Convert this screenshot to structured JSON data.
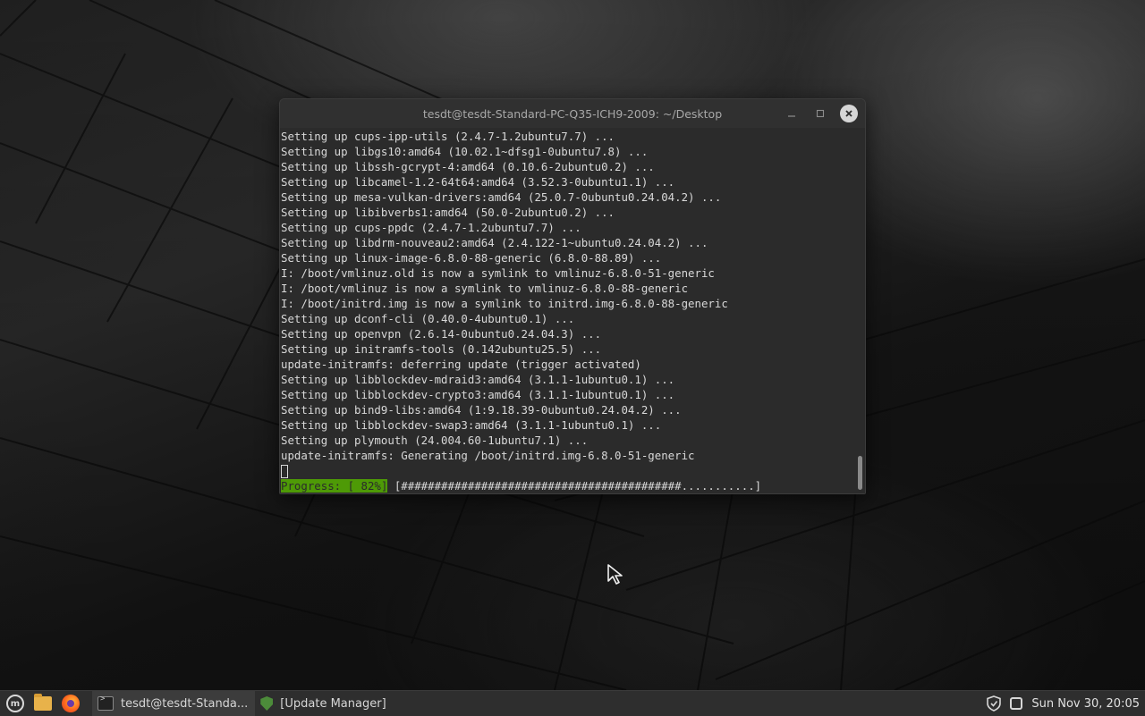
{
  "terminal": {
    "title": "tesdt@tesdt-Standard-PC-Q35-ICH9-2009: ~/Desktop",
    "lines": [
      "Setting up cups-ipp-utils (2.4.7-1.2ubuntu7.7) ...",
      "Setting up libgs10:amd64 (10.02.1~dfsg1-0ubuntu7.8) ...",
      "Setting up libssh-gcrypt-4:amd64 (0.10.6-2ubuntu0.2) ...",
      "Setting up libcamel-1.2-64t64:amd64 (3.52.3-0ubuntu1.1) ...",
      "Setting up mesa-vulkan-drivers:amd64 (25.0.7-0ubuntu0.24.04.2) ...",
      "Setting up libibverbs1:amd64 (50.0-2ubuntu0.2) ...",
      "Setting up cups-ppdc (2.4.7-1.2ubuntu7.7) ...",
      "Setting up libdrm-nouveau2:amd64 (2.4.122-1~ubuntu0.24.04.2) ...",
      "Setting up linux-image-6.8.0-88-generic (6.8.0-88.89) ...",
      "I: /boot/vmlinuz.old is now a symlink to vmlinuz-6.8.0-51-generic",
      "I: /boot/vmlinuz is now a symlink to vmlinuz-6.8.0-88-generic",
      "I: /boot/initrd.img is now a symlink to initrd.img-6.8.0-88-generic",
      "Setting up dconf-cli (0.40.0-4ubuntu0.1) ...",
      "Setting up openvpn (2.6.14-0ubuntu0.24.04.3) ...",
      "Setting up initramfs-tools (0.142ubuntu25.5) ...",
      "update-initramfs: deferring update (trigger activated)",
      "Setting up libblockdev-mdraid3:amd64 (3.1.1-1ubuntu0.1) ...",
      "Setting up libblockdev-crypto3:amd64 (3.1.1-1ubuntu0.1) ...",
      "Setting up bind9-libs:amd64 (1:9.18.39-0ubuntu0.24.04.2) ...",
      "Setting up libblockdev-swap3:amd64 (3.1.1-1ubuntu0.1) ...",
      "Setting up plymouth (24.004.60-1ubuntu7.1) ...",
      "update-initramfs: Generating /boot/initrd.img-6.8.0-51-generic"
    ],
    "progress_label": "Progress: [ 82%]",
    "progress_bar": " [##########################################...........]",
    "progress_percent": 82
  },
  "taskbar": {
    "tasks": [
      {
        "label": "tesdt@tesdt-Standa...",
        "icon": "terminal-icon"
      },
      {
        "label": "[Update Manager]",
        "icon": "update-manager-shield-icon"
      }
    ],
    "clock": "Sun Nov 30, 20:05"
  },
  "colors": {
    "terminal_bg": "#2b2b2b",
    "progress_green": "#4e9a06",
    "taskbar_bg": "#2e2e2e"
  }
}
